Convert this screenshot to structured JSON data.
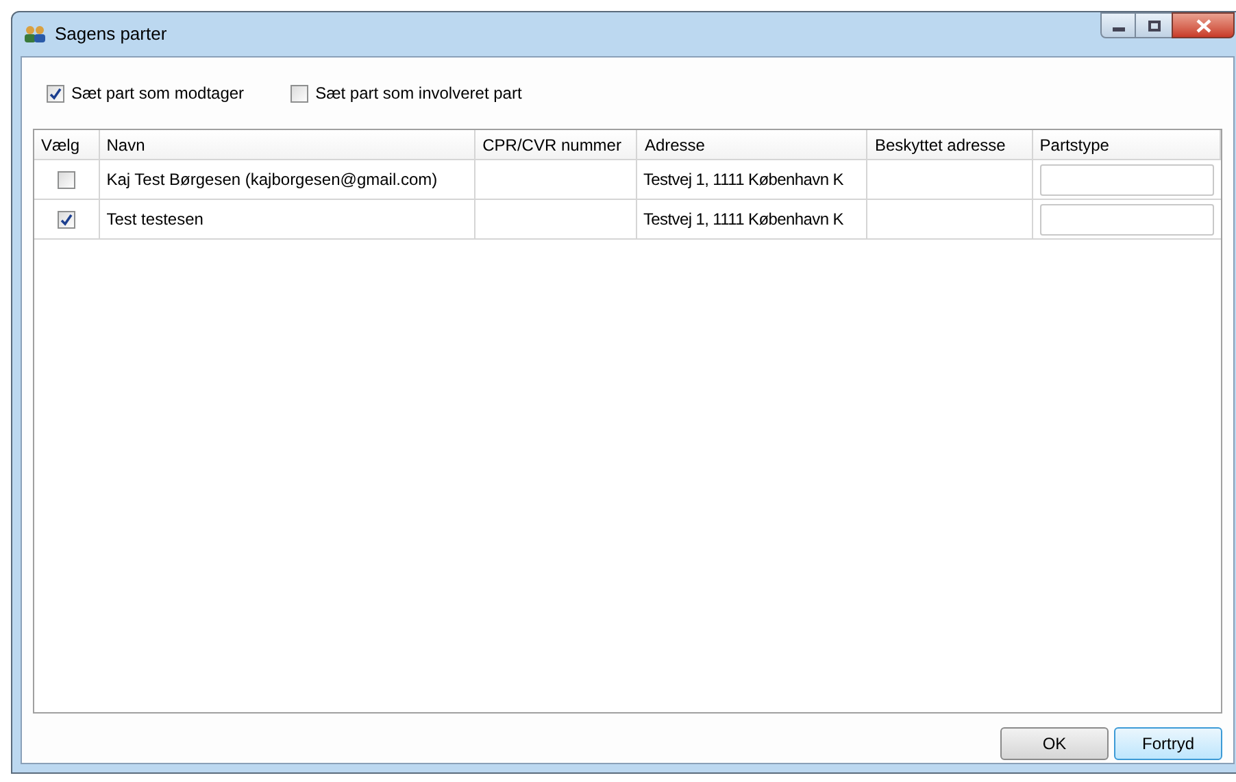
{
  "window": {
    "title": "Sagens parter"
  },
  "options": [
    {
      "label": "Sæt part som modtager",
      "checked": true
    },
    {
      "label": "Sæt part som involveret part",
      "checked": false
    }
  ],
  "table": {
    "columns": [
      "Vælg",
      "Navn",
      "CPR/CVR nummer",
      "Adresse",
      "Beskyttet adresse",
      "Partstype"
    ],
    "rows": [
      {
        "checked": false,
        "name": "Kaj Test Børgesen (kajborgesen@gmail.com)",
        "address": "Testvej 1, 1111 København K"
      },
      {
        "checked": true,
        "name": "Test testesen",
        "address": "Testvej 1, 1111 København K"
      }
    ]
  },
  "buttons": [
    {
      "label": "OK",
      "focused": false
    },
    {
      "label": "Fortryd",
      "focused": true
    }
  ]
}
